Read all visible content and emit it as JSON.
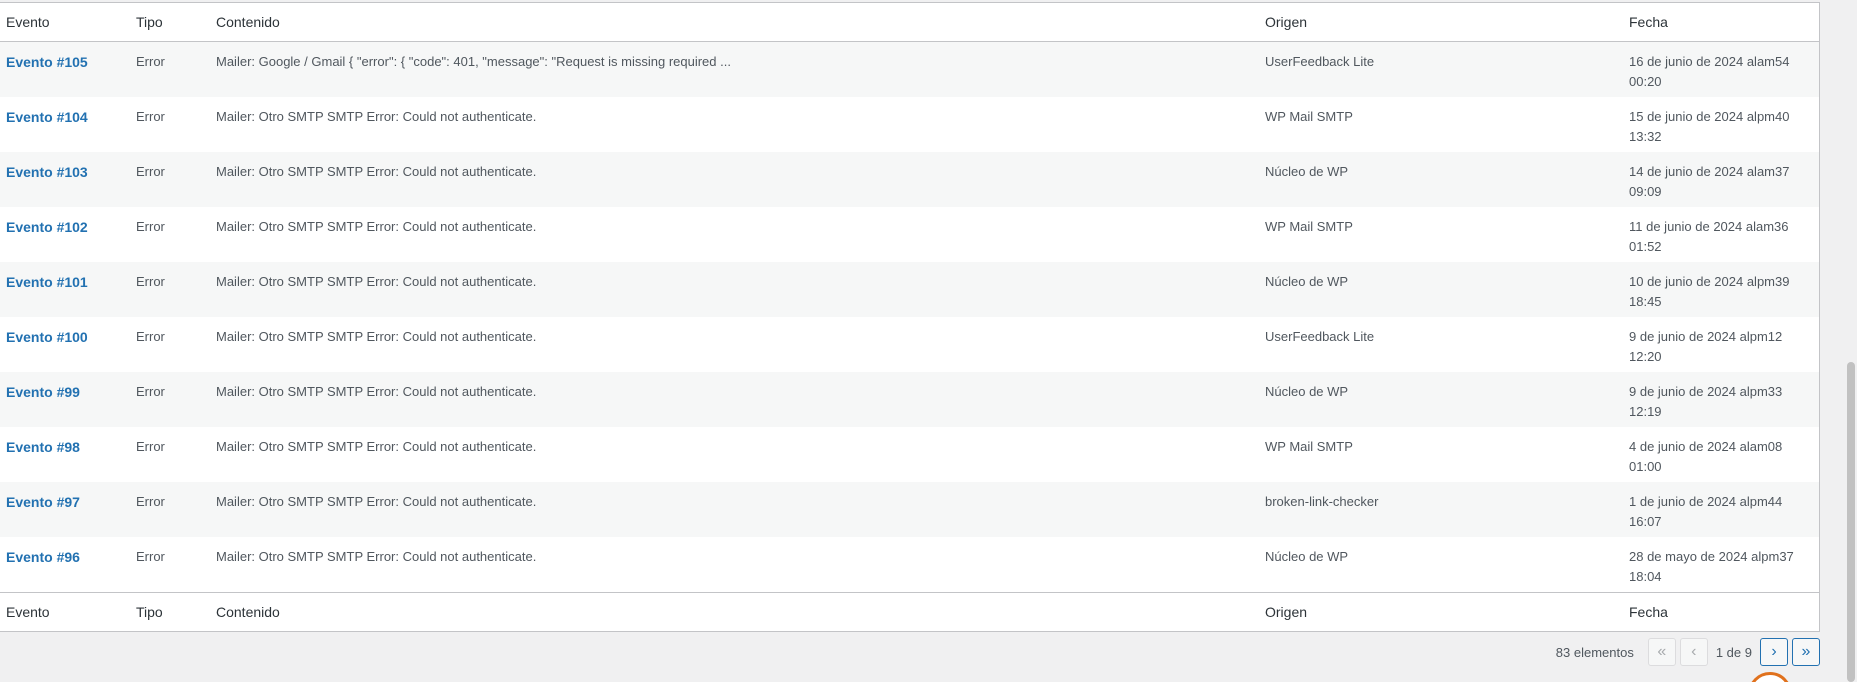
{
  "columns": {
    "evento": "Evento",
    "tipo": "Tipo",
    "contenido": "Contenido",
    "origen": "Origen",
    "fecha": "Fecha"
  },
  "rows": [
    {
      "evento": "Evento #105",
      "tipo": "Error",
      "contenido": "Mailer: Google / Gmail { \"error\": { \"code\": 401, \"message\": \"Request is missing required ...",
      "origen": "UserFeedback Lite",
      "fecha_line1": "16 de junio de 2024 alam54",
      "fecha_line2": "00:20"
    },
    {
      "evento": "Evento #104",
      "tipo": "Error",
      "contenido": "Mailer: Otro SMTP SMTP Error: Could not authenticate.",
      "origen": "WP Mail SMTP",
      "fecha_line1": "15 de junio de 2024 alpm40",
      "fecha_line2": "13:32"
    },
    {
      "evento": "Evento #103",
      "tipo": "Error",
      "contenido": "Mailer: Otro SMTP SMTP Error: Could not authenticate.",
      "origen": "Núcleo de WP",
      "fecha_line1": "14 de junio de 2024 alam37",
      "fecha_line2": "09:09"
    },
    {
      "evento": "Evento #102",
      "tipo": "Error",
      "contenido": "Mailer: Otro SMTP SMTP Error: Could not authenticate.",
      "origen": "WP Mail SMTP",
      "fecha_line1": "11 de junio de 2024 alam36",
      "fecha_line2": "01:52"
    },
    {
      "evento": "Evento #101",
      "tipo": "Error",
      "contenido": "Mailer: Otro SMTP SMTP Error: Could not authenticate.",
      "origen": "Núcleo de WP",
      "fecha_line1": "10 de junio de 2024 alpm39",
      "fecha_line2": "18:45"
    },
    {
      "evento": "Evento #100",
      "tipo": "Error",
      "contenido": "Mailer: Otro SMTP SMTP Error: Could not authenticate.",
      "origen": "UserFeedback Lite",
      "fecha_line1": "9 de junio de 2024 alpm12",
      "fecha_line2": "12:20"
    },
    {
      "evento": "Evento #99",
      "tipo": "Error",
      "contenido": "Mailer: Otro SMTP SMTP Error: Could not authenticate.",
      "origen": "Núcleo de WP",
      "fecha_line1": "9 de junio de 2024 alpm33",
      "fecha_line2": "12:19"
    },
    {
      "evento": "Evento #98",
      "tipo": "Error",
      "contenido": "Mailer: Otro SMTP SMTP Error: Could not authenticate.",
      "origen": "WP Mail SMTP",
      "fecha_line1": "4 de junio de 2024 alam08",
      "fecha_line2": "01:00"
    },
    {
      "evento": "Evento #97",
      "tipo": "Error",
      "contenido": "Mailer: Otro SMTP SMTP Error: Could not authenticate.",
      "origen": "broken-link-checker",
      "fecha_line1": "1 de junio de 2024 alpm44",
      "fecha_line2": "16:07"
    },
    {
      "evento": "Evento #96",
      "tipo": "Error",
      "contenido": "Mailer: Otro SMTP SMTP Error: Could not authenticate.",
      "origen": "Núcleo de WP",
      "fecha_line1": "28 de mayo de 2024 alpm37",
      "fecha_line2": "18:04"
    }
  ],
  "pagination": {
    "count": "83 elementos",
    "first": "«",
    "prev": "‹",
    "page_info": "1 de 9",
    "next": "›",
    "last": "»"
  },
  "colors": {
    "link": "#2271b1",
    "border": "#c3c4c7",
    "badge": "#e0711d"
  }
}
